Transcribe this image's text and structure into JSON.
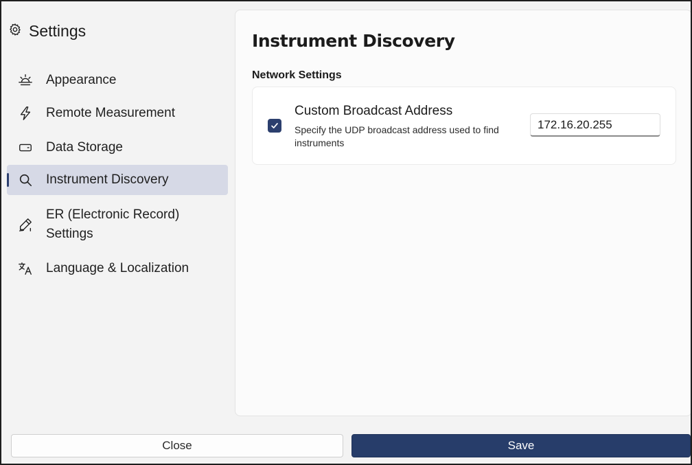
{
  "sidebar": {
    "title": "Settings",
    "title_icon": "gear-icon",
    "items": [
      {
        "label": "Appearance",
        "icon": "sunrise-icon"
      },
      {
        "label": "Remote Measurement",
        "icon": "lightning-icon"
      },
      {
        "label": "Data Storage",
        "icon": "drive-icon"
      },
      {
        "label": "Instrument Discovery",
        "icon": "search-icon",
        "active": true
      },
      {
        "label": "ER (Electronic Record)",
        "label_line2": "Settings",
        "icon": "signature-icon"
      },
      {
        "label": "Language & Localization",
        "icon": "translate-icon"
      }
    ]
  },
  "main": {
    "title": "Instrument Discovery",
    "section_label": "Network Settings",
    "setting": {
      "title": "Custom Broadcast Address",
      "description": "Specify the UDP broadcast address used to find instruments",
      "checked": true,
      "value": "172.16.20.255"
    }
  },
  "footer": {
    "close_label": "Close",
    "save_label": "Save"
  },
  "colors": {
    "accent": "#273d6a",
    "active_nav_bg": "#d6d9e6",
    "window_bg": "#f3f3f3"
  }
}
